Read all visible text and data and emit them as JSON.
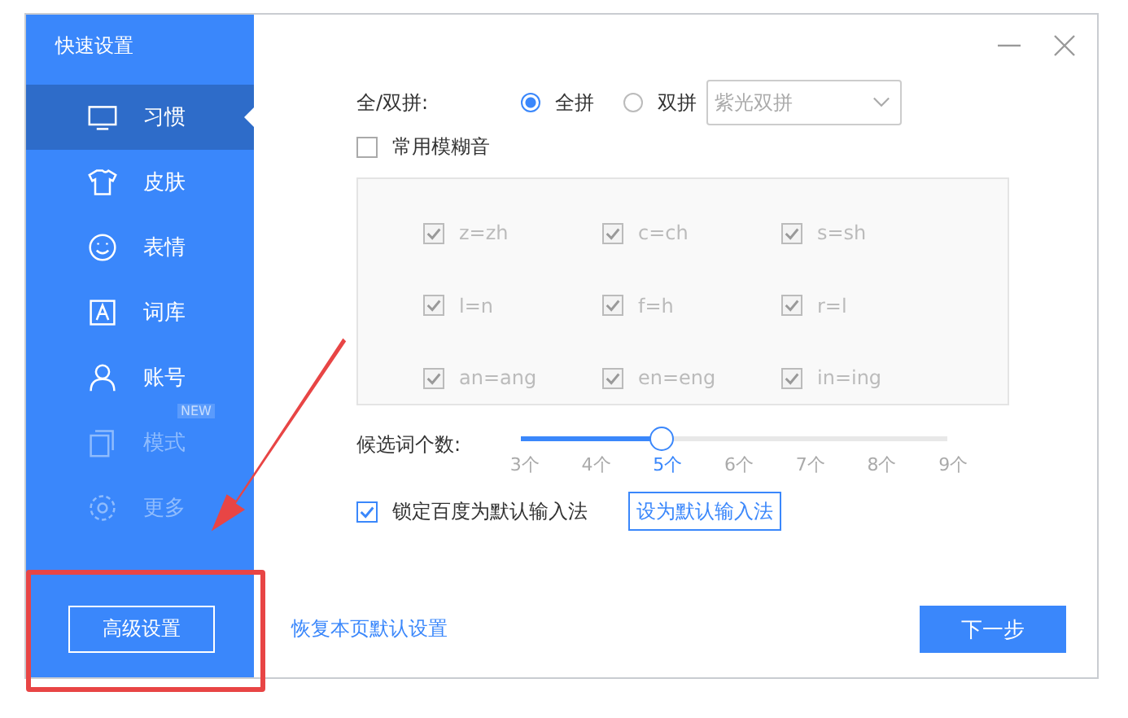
{
  "sidebar": {
    "title": "快速设置",
    "items": [
      {
        "label": "习惯",
        "selected": true,
        "disabled": false
      },
      {
        "label": "皮肤",
        "selected": false,
        "disabled": false
      },
      {
        "label": "表情",
        "selected": false,
        "disabled": false
      },
      {
        "label": "词库",
        "selected": false,
        "disabled": false
      },
      {
        "label": "账号",
        "selected": false,
        "disabled": false
      },
      {
        "label": "模式",
        "selected": false,
        "disabled": true,
        "badge": "NEW"
      },
      {
        "label": "更多",
        "selected": false,
        "disabled": true
      }
    ],
    "advanced_button": "高级设置"
  },
  "pinyin": {
    "label": "全/双拼:",
    "options": [
      {
        "label": "全拼",
        "selected": true
      },
      {
        "label": "双拼",
        "selected": false
      }
    ],
    "scheme": {
      "value": "紫光双拼",
      "disabled": true
    }
  },
  "fuzzy": {
    "label": "常用模糊音",
    "checked": false,
    "pairs": [
      {
        "label": "z=zh",
        "checked": true
      },
      {
        "label": "c=ch",
        "checked": true
      },
      {
        "label": "s=sh",
        "checked": true
      },
      {
        "label": "l=n",
        "checked": true
      },
      {
        "label": "f=h",
        "checked": true
      },
      {
        "label": "r=l",
        "checked": true
      },
      {
        "label": "an=ang",
        "checked": true
      },
      {
        "label": "en=eng",
        "checked": true
      },
      {
        "label": "in=ing",
        "checked": true
      }
    ]
  },
  "candidates": {
    "label": "候选词个数:",
    "level": 0.333,
    "ticks": [
      {
        "label": "3个",
        "selected": false
      },
      {
        "label": "4个",
        "selected": false
      },
      {
        "label": "5个",
        "selected": true
      },
      {
        "label": "6个",
        "selected": false
      },
      {
        "label": "7个",
        "selected": false
      },
      {
        "label": "8个",
        "selected": false
      },
      {
        "label": "9个",
        "selected": false
      }
    ]
  },
  "lock": {
    "label": "锁定百度为默认输入法",
    "checked": true,
    "button": "设为默认输入法"
  },
  "footer": {
    "restore_link": "恢复本页默认设置",
    "next_button": "下一步"
  }
}
